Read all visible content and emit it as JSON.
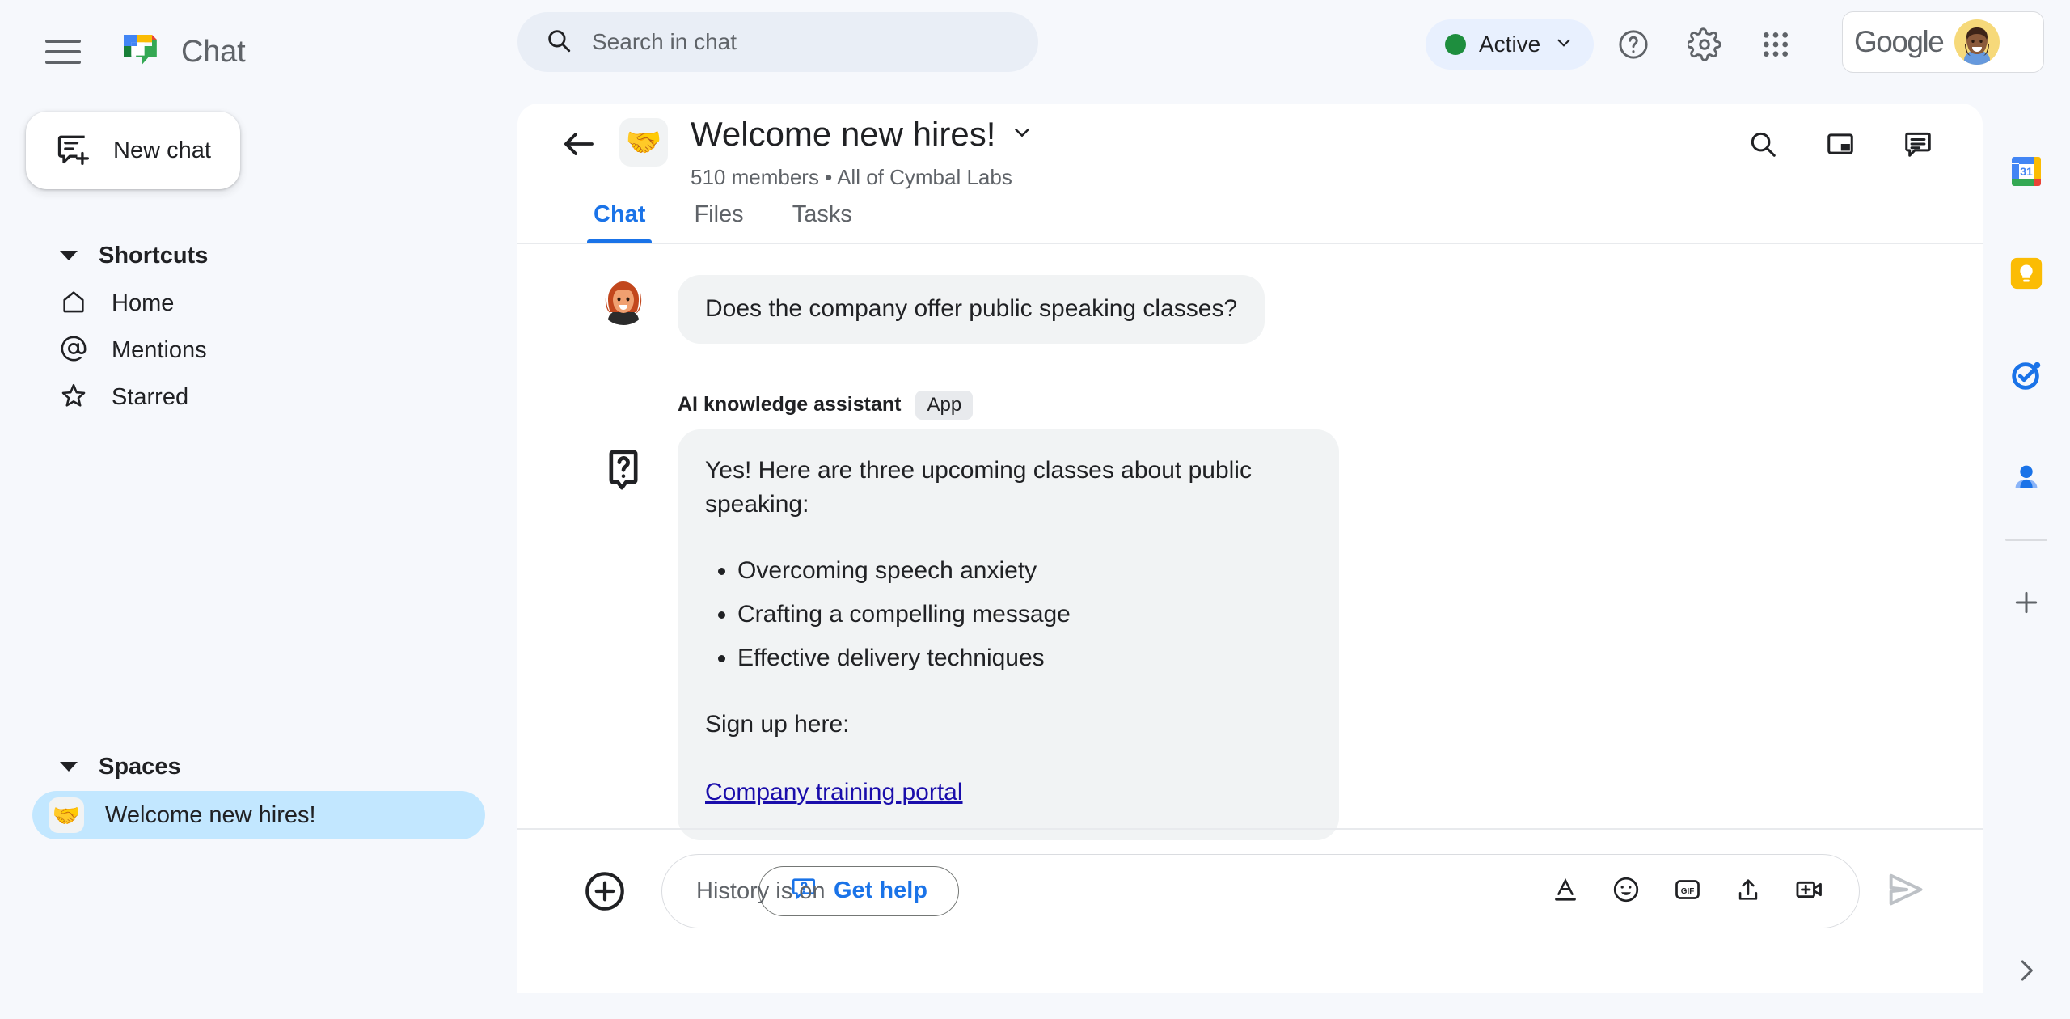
{
  "app": {
    "brand_name": "Chat",
    "menu_icon": "hamburger-icon",
    "logo_icon": "google-chat-logo"
  },
  "search": {
    "placeholder": "Search in chat",
    "icon": "search-icon"
  },
  "topbar": {
    "status_label": "Active",
    "status_color": "#1e8e3e",
    "status_caret": "chevron-down-icon",
    "help_icon": "help-circle-icon",
    "settings_icon": "gear-icon",
    "apps_icon": "apps-grid-icon",
    "account_brand": "Google",
    "avatar_icon": "user-avatar"
  },
  "sidebar": {
    "new_chat": {
      "label": "New chat",
      "icon": "new-chat-icon"
    },
    "shortcuts": {
      "title": "Shortcuts",
      "items": [
        {
          "label": "Home",
          "icon": "home-icon"
        },
        {
          "label": "Mentions",
          "icon": "at-sign-icon"
        },
        {
          "label": "Starred",
          "icon": "star-icon"
        }
      ]
    },
    "spaces": {
      "title": "Spaces",
      "items": [
        {
          "label": "Welcome new hires!",
          "emoji": "🤝",
          "selected": true
        }
      ]
    }
  },
  "conversation": {
    "back_icon": "back-arrow-icon",
    "emoji": "🤝",
    "title": "Welcome new hires!",
    "title_caret": "chevron-down-icon",
    "subtitle": "510 members  •  All of Cymbal Labs",
    "actions": [
      {
        "icon": "search-icon"
      },
      {
        "icon": "picture-in-picture-icon"
      },
      {
        "icon": "chat-bubble-icon"
      }
    ],
    "tabs": [
      {
        "label": "Chat",
        "active": true
      },
      {
        "label": "Files",
        "active": false
      },
      {
        "label": "Tasks",
        "active": false
      }
    ]
  },
  "messages": {
    "user_message": {
      "avatar": "woman-avatar",
      "text": "Does the company offer public speaking classes?"
    },
    "ai_message": {
      "sender": "AI knowledge assistant",
      "badge": "App",
      "icon": "question-bubble-icon",
      "intro": "Yes! Here are three upcoming classes about public speaking:",
      "bullets": [
        "Overcoming speech anxiety",
        "Crafting a compelling message",
        "Effective delivery techniques"
      ],
      "signup_text": "Sign up here:",
      "link_label": "Company training portal"
    },
    "get_help": {
      "label": "Get help",
      "icon": "help-bubble-icon",
      "color": "#1a73e8"
    }
  },
  "composer": {
    "add_icon": "plus-circle-icon",
    "placeholder": "History is on",
    "icons": [
      {
        "name": "format-text-icon",
        "glyph": "A"
      },
      {
        "name": "emoji-icon"
      },
      {
        "name": "gif-icon",
        "glyph": "GIF"
      },
      {
        "name": "upload-icon"
      },
      {
        "name": "video-add-icon"
      }
    ],
    "send_icon": "send-icon"
  },
  "right_rail": {
    "items": [
      {
        "name": "google-calendar-icon",
        "label": "31"
      },
      {
        "name": "google-keep-icon"
      },
      {
        "name": "google-tasks-icon"
      },
      {
        "name": "google-contacts-icon"
      }
    ],
    "add_icon": "plus-icon",
    "expand_icon": "chevron-right-icon"
  }
}
